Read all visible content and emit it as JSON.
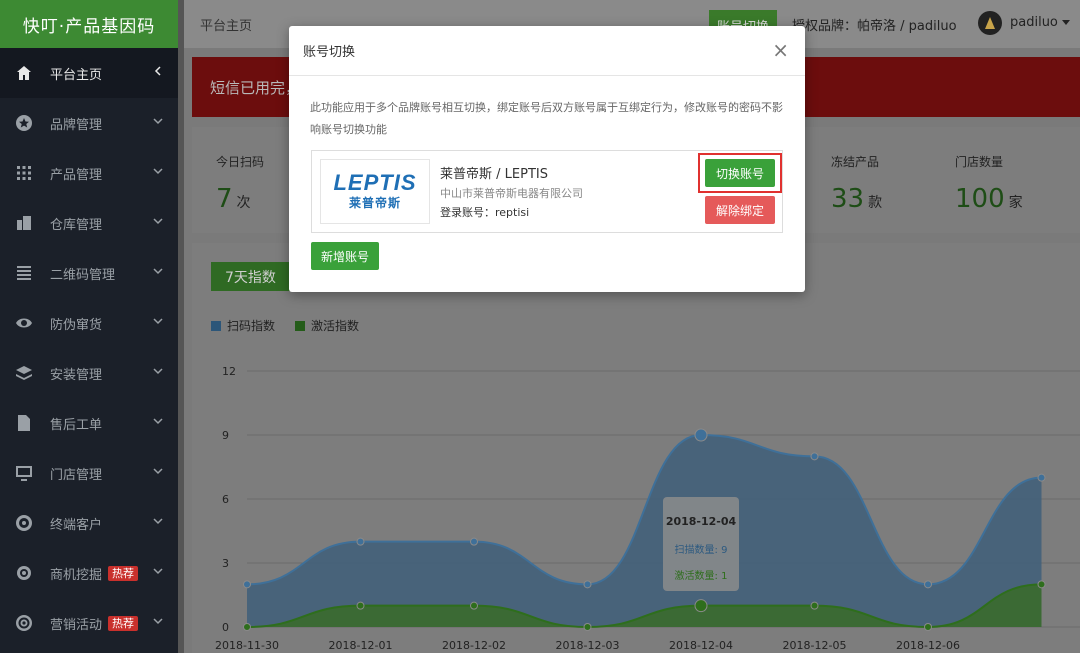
{
  "sidebar": {
    "title": "快叮·产品基因码",
    "items": [
      {
        "label": "平台主页",
        "icon": "home-icon",
        "active": true
      },
      {
        "label": "品牌管理",
        "icon": "star-icon"
      },
      {
        "label": "产品管理",
        "icon": "grid-icon"
      },
      {
        "label": "仓库管理",
        "icon": "building-icon"
      },
      {
        "label": "二维码管理",
        "icon": "qrcode-icon"
      },
      {
        "label": "防伪窜货",
        "icon": "eye-icon"
      },
      {
        "label": "安装管理",
        "icon": "layers-icon"
      },
      {
        "label": "售后工单",
        "icon": "file-icon"
      },
      {
        "label": "门店管理",
        "icon": "monitor-icon"
      },
      {
        "label": "终端客户",
        "icon": "globe-icon"
      },
      {
        "label": "商机挖掘",
        "icon": "target-icon",
        "badge": "热荐"
      },
      {
        "label": "营销活动",
        "icon": "broadcast-icon",
        "badge": "热荐"
      }
    ]
  },
  "topbar": {
    "breadcrumb": "平台主页",
    "switch_label": "账号切换",
    "brand_label": "授权品牌：帕帝洛 / padiluo",
    "username": "padiluo"
  },
  "alert": {
    "text": "短信已用完，"
  },
  "stats": [
    {
      "title": "今日扫码",
      "value": "7",
      "unit": "次"
    },
    {
      "title": "冻结产品",
      "value": "33",
      "unit": "款"
    },
    {
      "title": "门店数量",
      "value": "100",
      "unit": "家"
    }
  ],
  "chart_panel": {
    "button_label": "7天指数"
  },
  "chart_data": {
    "type": "area",
    "x": [
      "2018-11-30",
      "2018-12-01",
      "2018-12-02",
      "2018-12-03",
      "2018-12-04",
      "2018-12-05",
      "2018-12-06",
      "2018-12-07"
    ],
    "x_tick_labels": [
      "2018-11-30",
      "2018-12-01",
      "2018-12-02",
      "2018-12-03",
      "2018-12-04",
      "2018-12-05",
      "2018-12-06"
    ],
    "series": [
      {
        "name": "扫码指数",
        "color": "#4a8fc9",
        "values": [
          2,
          4,
          4,
          2,
          9,
          8,
          2,
          7
        ]
      },
      {
        "name": "激活指数",
        "color": "#3c9a2a",
        "values": [
          0,
          1,
          1,
          0,
          1,
          1,
          0,
          2
        ]
      }
    ],
    "yticks": [
      0,
      3,
      6,
      9,
      12
    ],
    "ylim": [
      0,
      12
    ],
    "tooltip": {
      "date": "2018-12-04",
      "scan_label": "扫描数量: 9",
      "activate_label": "激活数量: 1"
    }
  },
  "modal": {
    "title": "账号切换",
    "close_symbol": "×",
    "description": "此功能应用于多个品牌账号相互切换，绑定账号后双方账号属于互绑定行为，修改账号的密码不影响账号切换功能",
    "account": {
      "logo_en": "LEPTIS",
      "logo_cn": "莱普帝斯",
      "name": "莱普帝斯 / LEPTIS",
      "company": "中山市莱普帝斯电器有限公司",
      "login": "登录账号：reptisi"
    },
    "switch_button": "切换账号",
    "unbind_button": "解除绑定",
    "add_button": "新增账号"
  }
}
